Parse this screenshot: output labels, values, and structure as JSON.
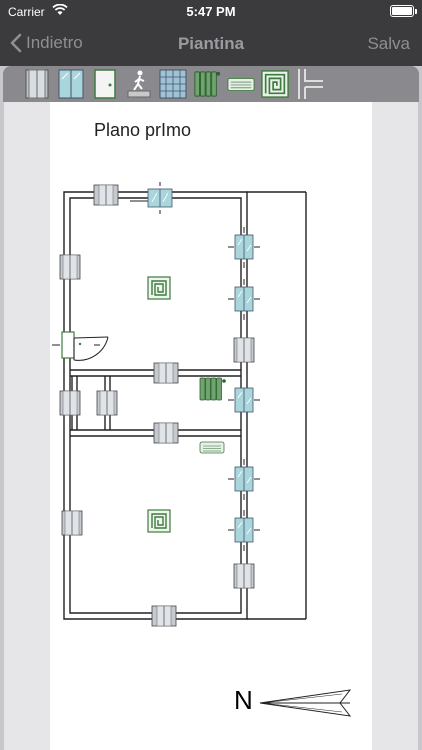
{
  "status": {
    "carrier": "Carrier",
    "time": "5:47 PM"
  },
  "nav": {
    "back_label": "Indietro",
    "title": "Piantina",
    "save_label": "Salva"
  },
  "toolbar": {
    "tools": [
      {
        "icon": "door-panel-icon"
      },
      {
        "icon": "window-icon"
      },
      {
        "icon": "door-icon"
      },
      {
        "icon": "stairs-icon"
      },
      {
        "icon": "panel-grid-icon"
      },
      {
        "icon": "radiator-icon"
      },
      {
        "icon": "ac-unit-icon"
      },
      {
        "icon": "floor-heating-icon"
      },
      {
        "icon": "pipe-icon"
      }
    ]
  },
  "plan": {
    "title": "Plano prImo",
    "north_label": "N"
  },
  "colors": {
    "bar": "#3b3b3d",
    "toolbar": "#8a8a8e",
    "window": "#a9d5dc",
    "heating": "#3f7a3f"
  }
}
